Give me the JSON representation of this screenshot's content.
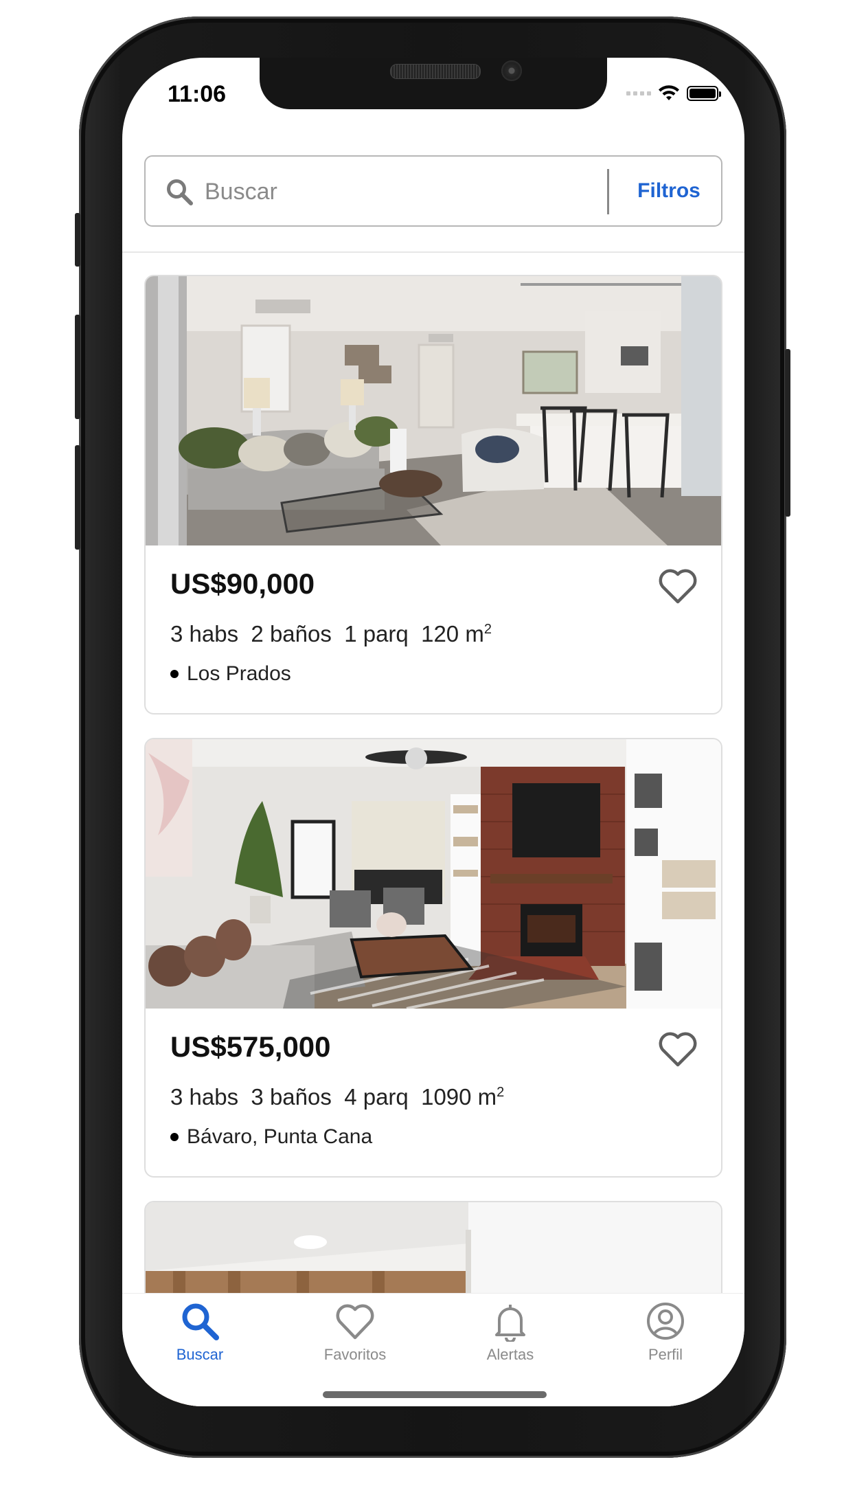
{
  "status_bar": {
    "time": "11:06"
  },
  "search": {
    "placeholder": "Buscar",
    "filters_label": "Filtros"
  },
  "listings": [
    {
      "price": "US$90,000",
      "specs": "3 habs  2 baños  1 parq  120 m",
      "area_sup": "2",
      "location": "Los Prados"
    },
    {
      "price": "US$575,000",
      "specs": "3 habs  3 baños  4 parq  1090 m",
      "area_sup": "2",
      "location": "Bávaro, Punta Cana"
    }
  ],
  "tabs": [
    {
      "label": "Buscar",
      "icon": "search-icon",
      "active": true
    },
    {
      "label": "Favoritos",
      "icon": "heart-icon",
      "active": false
    },
    {
      "label": "Alertas",
      "icon": "bell-icon",
      "active": false
    },
    {
      "label": "Perfil",
      "icon": "user-circle-icon",
      "active": false
    }
  ],
  "colors": {
    "accent": "#1f64d2",
    "inactive": "#8a8a8a",
    "frame": "#151515"
  }
}
